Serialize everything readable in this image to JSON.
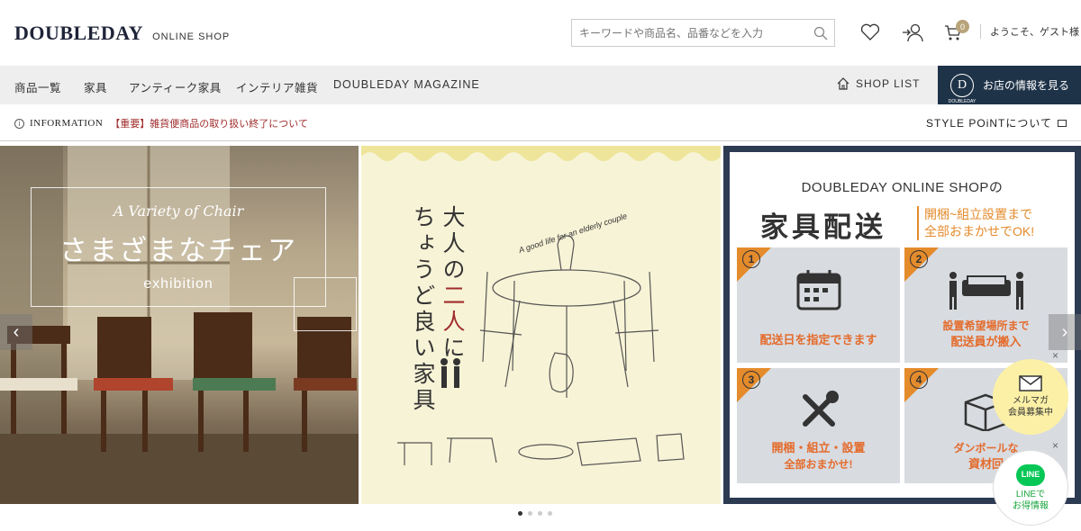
{
  "header": {
    "logo": "DOUBLEDAY",
    "logo_sub": "ONLINE SHOP",
    "search_placeholder": "キーワードや商品名、品番などを入力",
    "cart_count": "0",
    "welcome": "ようこそ、ゲスト様",
    "icons": [
      "heart-icon",
      "login-icon",
      "cart-icon",
      "search-icon"
    ]
  },
  "nav": {
    "items": [
      "商品一覧",
      "家具",
      "アンティーク家具",
      "インテリア雑貨",
      "DOUBLEDAY MAGAZINE"
    ],
    "shop_list": "SHOP LIST",
    "store_logo": "D",
    "store_logo_sub": "DOUBLEDAY",
    "store_info": "お店の情報を見る"
  },
  "info": {
    "label": "INFORMATION",
    "link": "【重要】雑貨便商品の取り扱い終了について",
    "style_point": "STYLE POiNTについて"
  },
  "slides": {
    "s1": {
      "sub": "A Variety of Chair",
      "title": "さまざまなチェア",
      "ex": "exhibition"
    },
    "s2": {
      "line1_a": "大人の",
      "line1_b": "二人",
      "line1_c": "に",
      "line2": "ちょうど良い家具",
      "arc": "A good life for an elderly couple"
    },
    "s3": {
      "title": "DOUBLEDAY ONLINE SHOPの",
      "big": "家具配送",
      "side1": "開梱~組立設置まで",
      "side2": "全部おまかせでOK!",
      "cells": [
        {
          "num": "1",
          "cap1": "配送日を指定できます",
          "cap2": ""
        },
        {
          "num": "2",
          "cap1": "設置希望場所まで",
          "cap2": "配送員が搬入"
        },
        {
          "num": "3",
          "cap1": "開梱・組立・設置",
          "cap2": "全部おまかせ!"
        },
        {
          "num": "4",
          "cap1": "ダンボールな",
          "cap2": "資材回"
        }
      ]
    }
  },
  "float": {
    "mail1": "メルマガ",
    "mail2": "会員募集中",
    "line_icon": "LINE",
    "line1": "LINEで",
    "line2": "お得情報",
    "close": "×"
  },
  "arrows": {
    "prev": "‹",
    "next": "›"
  },
  "colors": {
    "navy": "#1f3348",
    "accent": "#e48b2c",
    "red": "#a02c2c"
  }
}
